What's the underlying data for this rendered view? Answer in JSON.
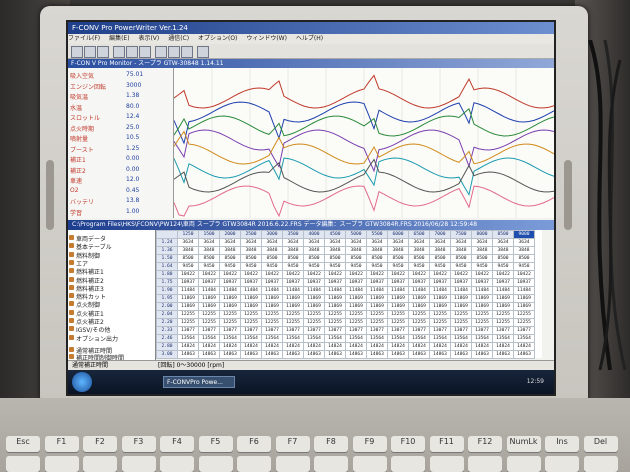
{
  "window": {
    "title": "F-CONV Pro PowerWriter Ver.1.24"
  },
  "menu": [
    "ファイル(F)",
    "編集(E)",
    "表示(V)",
    "通信(C)",
    "オプション(O)",
    "ウィンドウ(W)",
    "ヘルプ(H)"
  ],
  "monitor": {
    "title": "F-CON V Pro Monitor - スープラ GTW-30848 1.14.11",
    "params": [
      {
        "label": "吸入空気",
        "value": "75.01"
      },
      {
        "label": "エンジン回転",
        "value": "3000"
      },
      {
        "label": "吸気温",
        "value": "1.38"
      },
      {
        "label": "水温",
        "value": "80.0"
      },
      {
        "label": "スロットル",
        "value": "12.4"
      },
      {
        "label": "点火時期",
        "value": "25.0"
      },
      {
        "label": "噴射量",
        "value": "10.5"
      },
      {
        "label": "ブースト",
        "value": "1.25"
      },
      {
        "label": "補正1",
        "value": "0.00"
      },
      {
        "label": "補正2",
        "value": "0.00"
      },
      {
        "label": "車速",
        "value": "12.0"
      },
      {
        "label": "O2",
        "value": "0.45"
      },
      {
        "label": "バッテリ",
        "value": "13.8"
      },
      {
        "label": "学習",
        "value": "1.00"
      }
    ]
  },
  "editor": {
    "title": "C:\\Program Files\\HKS\\FCONV\\PW124\\車両 スープラ GTW3084R 2016.6.22.FRS     データ編集：スープラ GTW3084R.FRS 2016/06/28 12:59:48",
    "tree": [
      "車両データ",
      "基本テーブル",
      "燃料制御",
      "エア",
      "燃料補正1",
      "燃料補正2",
      "燃料補正3",
      "燃料カット",
      "点火制御",
      "点火補正1",
      "点火補正2",
      "IGSV/その他",
      "オプション出力"
    ],
    "tree_sub": [
      "通常補正時間",
      "補正時間制御時間"
    ],
    "columns": [
      "1250",
      "1500",
      "2000",
      "2500",
      "3000",
      "3500",
      "4000",
      "4500",
      "5000",
      "5500",
      "6000",
      "6500",
      "7000",
      "7500",
      "8000",
      "8500",
      "9000"
    ],
    "rows": [
      {
        "head": "1.24",
        "vals": [
          "3634",
          "3634",
          "3634",
          "3634",
          "3634",
          "3634",
          "3634",
          "3634",
          "3634",
          "3634",
          "3634",
          "3634",
          "3634",
          "3634",
          "3634",
          "3634",
          "3634"
        ]
      },
      {
        "head": "1.36",
        "vals": [
          "3848",
          "3848",
          "3848",
          "3848",
          "3848",
          "3848",
          "3848",
          "3848",
          "3848",
          "3848",
          "3848",
          "3848",
          "3848",
          "3848",
          "3848",
          "3848",
          "3848"
        ]
      },
      {
        "head": "1.50",
        "vals": [
          "8500",
          "8500",
          "8500",
          "8500",
          "8500",
          "8500",
          "8500",
          "8500",
          "8500",
          "8500",
          "8500",
          "8500",
          "8500",
          "8500",
          "8500",
          "8500",
          "8500"
        ]
      },
      {
        "head": "1.64",
        "vals": [
          "9450",
          "9450",
          "9450",
          "9450",
          "9450",
          "9450",
          "9450",
          "9450",
          "9450",
          "9450",
          "9450",
          "9450",
          "9450",
          "9450",
          "9450",
          "9450",
          "9450"
        ]
      },
      {
        "head": "1.80",
        "vals": [
          "10422",
          "10422",
          "10422",
          "10422",
          "10422",
          "10422",
          "10422",
          "10422",
          "10422",
          "10422",
          "10422",
          "10422",
          "10422",
          "10422",
          "10422",
          "10422",
          "10422"
        ]
      },
      {
        "head": "1.75",
        "vals": [
          "10937",
          "10937",
          "10937",
          "10937",
          "10937",
          "10937",
          "10937",
          "10937",
          "10937",
          "10937",
          "10937",
          "10937",
          "10937",
          "10937",
          "10937",
          "10937",
          "10937"
        ]
      },
      {
        "head": "1.90",
        "vals": [
          "11484",
          "11484",
          "11484",
          "11484",
          "11484",
          "11484",
          "11484",
          "11484",
          "11484",
          "11484",
          "11484",
          "11484",
          "11484",
          "11484",
          "11484",
          "11484",
          "11484"
        ]
      },
      {
        "head": "1.95",
        "vals": [
          "11869",
          "11869",
          "11869",
          "11869",
          "11869",
          "11869",
          "11869",
          "11869",
          "11869",
          "11869",
          "11869",
          "11869",
          "11869",
          "11869",
          "11869",
          "11869",
          "11869"
        ]
      },
      {
        "head": "2.00",
        "vals": [
          "11869",
          "11869",
          "11869",
          "11869",
          "11869",
          "11869",
          "11869",
          "11869",
          "11869",
          "11869",
          "11869",
          "11869",
          "11869",
          "11869",
          "11869",
          "11869",
          "11869"
        ]
      },
      {
        "head": "2.04",
        "vals": [
          "12255",
          "12255",
          "12255",
          "12255",
          "12255",
          "12255",
          "12255",
          "12255",
          "12255",
          "12255",
          "12255",
          "12255",
          "12255",
          "12255",
          "12255",
          "12255",
          "12255"
        ]
      },
      {
        "head": "2.20",
        "vals": [
          "12255",
          "12255",
          "12255",
          "12255",
          "12255",
          "12255",
          "12255",
          "12255",
          "12255",
          "12255",
          "12255",
          "12255",
          "12255",
          "12255",
          "12255",
          "12255",
          "12255"
        ]
      },
      {
        "head": "2.33",
        "vals": [
          "13077",
          "13077",
          "13077",
          "13077",
          "13077",
          "13077",
          "13077",
          "13077",
          "13077",
          "13077",
          "13077",
          "13077",
          "13077",
          "13077",
          "13077",
          "13077",
          "13077"
        ]
      },
      {
        "head": "2.46",
        "vals": [
          "13564",
          "13564",
          "13564",
          "13564",
          "13564",
          "13564",
          "13564",
          "13564",
          "13564",
          "13564",
          "13564",
          "13564",
          "13564",
          "13564",
          "13564",
          "13564",
          "13564"
        ]
      },
      {
        "head": "2.80",
        "vals": [
          "14824",
          "14824",
          "14824",
          "14824",
          "14824",
          "14824",
          "14824",
          "14824",
          "14824",
          "14824",
          "14824",
          "14824",
          "14824",
          "14824",
          "14824",
          "14824",
          "14824"
        ]
      },
      {
        "head": "3.00",
        "vals": [
          "14863",
          "14863",
          "14863",
          "14863",
          "14863",
          "14863",
          "14863",
          "14863",
          "14863",
          "14863",
          "14863",
          "14863",
          "14863",
          "14863",
          "14863",
          "14863",
          "14863"
        ]
      }
    ]
  },
  "status": {
    "left": "通常補正時間",
    "right": "[回転] 0～30000 [rpm]"
  },
  "taskbar": {
    "app": "F-CONVPro Powe...",
    "clock": "12:59"
  },
  "keyboard": [
    "Esc",
    "F1",
    "F2",
    "F3",
    "F4",
    "F5",
    "F6",
    "F7",
    "F8",
    "F9",
    "F10",
    "F11",
    "F12",
    "NumLk",
    "Ins",
    "Del"
  ],
  "colors": {
    "series": [
      "#c0392b",
      "#1e3fae",
      "#2a8a3a",
      "#7a3fb0",
      "#d08a1a",
      "#1a9ab0",
      "#555555",
      "#e26b8a"
    ]
  }
}
